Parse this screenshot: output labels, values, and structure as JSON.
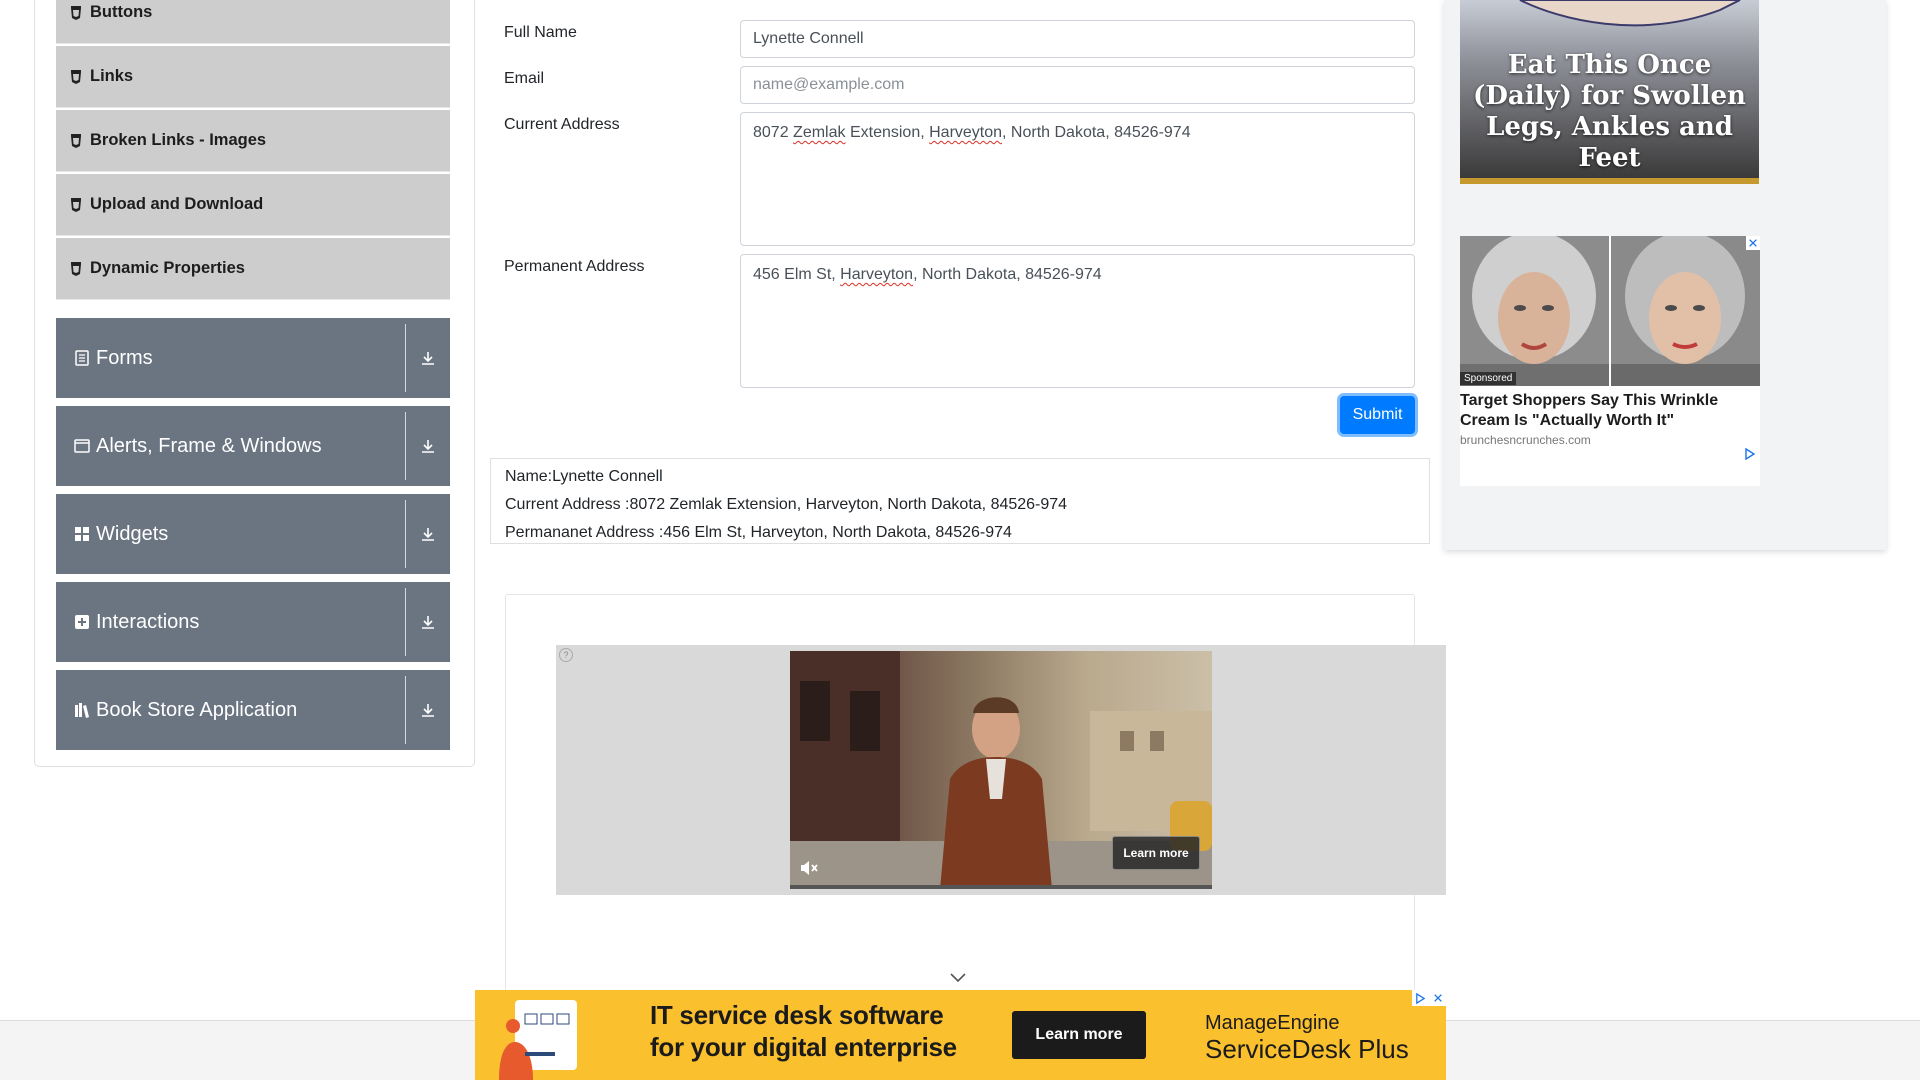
{
  "sidebar": {
    "sub_items": [
      {
        "label": "Buttons"
      },
      {
        "label": "Links"
      },
      {
        "label": "Broken Links - Images"
      },
      {
        "label": "Upload and Download"
      },
      {
        "label": "Dynamic Properties"
      }
    ],
    "groups": [
      {
        "label": "Forms",
        "icon": "form-icon"
      },
      {
        "label": "Alerts, Frame & Windows",
        "icon": "window-icon"
      },
      {
        "label": "Widgets",
        "icon": "widgets-icon"
      },
      {
        "label": "Interactions",
        "icon": "interactions-icon"
      },
      {
        "label": "Book Store Application",
        "icon": "books-icon"
      }
    ]
  },
  "form": {
    "full_name": {
      "label": "Full Name",
      "value": "Lynette Connell"
    },
    "email": {
      "label": "Email",
      "value": "",
      "placeholder": "name@example.com"
    },
    "current_address": {
      "label": "Current Address",
      "value": "8072 Zemlak Extension, Harveyton, North Dakota, 84526-974"
    },
    "permanent_address": {
      "label": "Permanent Address",
      "value": "456 Elm St, Harveyton, North Dakota, 84526-974"
    },
    "submit_label": "Submit"
  },
  "output": {
    "name": "Name:Lynette Connell",
    "current_address": "Current Address :8072 Zemlak Extension, Harveyton, North Dakota, 84526-974",
    "permanent_address": "Permananet Address :456 Elm St, Harveyton, North Dakota, 84526-974"
  },
  "video_ad": {
    "learn_more": "Learn more",
    "question_mark": "?"
  },
  "banner_ad": {
    "headline_1": "IT service desk software",
    "headline_2": "for your digital enterprise",
    "button": "Learn more",
    "brand_1": "ManageEngine",
    "brand_2": "ServiceDesk Plus",
    "bg_color": "#fbc02d"
  },
  "right_ads": {
    "top_ad_text": "Eat This Once (Daily) for Swollen Legs, Ankles and Feet",
    "card": {
      "sponsored": "Sponsored",
      "title": "Target Shoppers Say This Wrinkle Cream Is \"Actually Worth It\"",
      "domain": "brunchesncrunches.com"
    }
  },
  "colors": {
    "accent": "#007bff",
    "sidebar_group": "#6a7581",
    "sidebar_sub": "#cdcdcd"
  }
}
